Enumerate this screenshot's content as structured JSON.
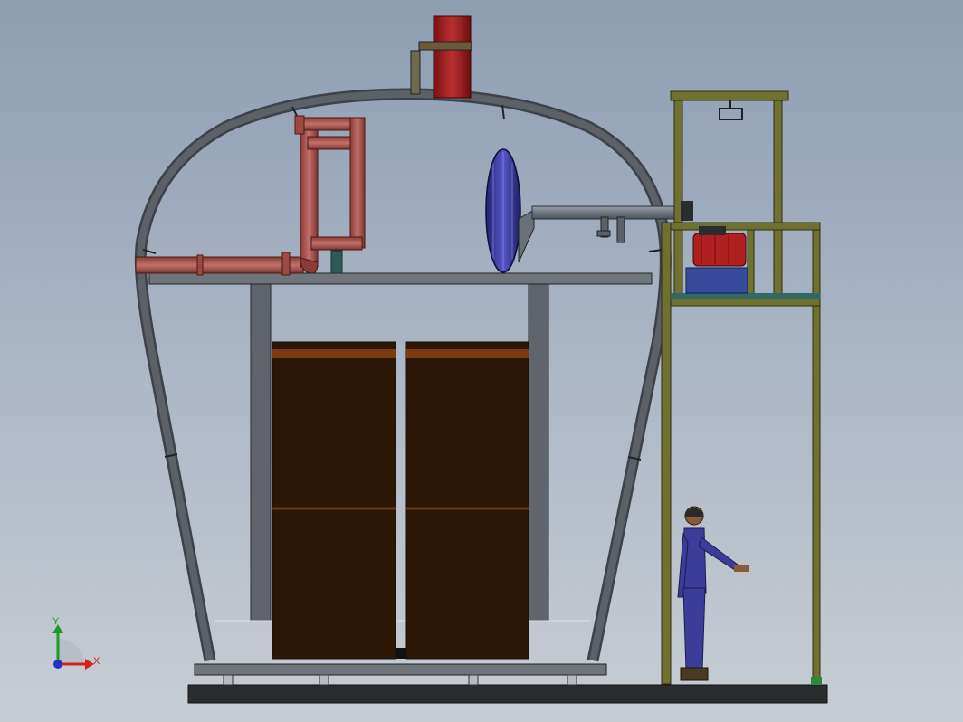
{
  "viewer": {
    "background_top": "#8e9db2",
    "background_bottom": "#c8cdd4"
  },
  "axes_triad": {
    "x_label": "X",
    "y_label": "Y",
    "x_color": "#d62020",
    "y_color": "#1c9a2a",
    "z_color": "#2030c8"
  },
  "model": {
    "frame_color": "#55595f",
    "pipe_color": "#b0605a",
    "panel_color": "#2c1606",
    "fan_color": "#3a3aa8",
    "tower_color": "#707030",
    "motor_color": "#b02020",
    "stack_color": "#a81e1e",
    "worker_color": "#3c3c9a"
  }
}
